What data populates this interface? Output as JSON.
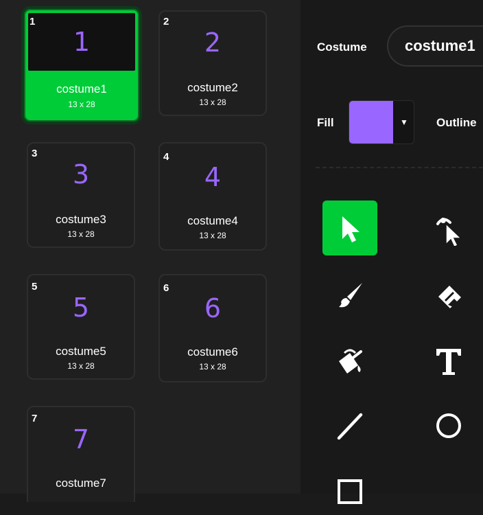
{
  "costumes": [
    {
      "index": "1",
      "thumb": "1",
      "name": "costume1",
      "size": "13 x 28",
      "selected": true
    },
    {
      "index": "2",
      "thumb": "2",
      "name": "costume2",
      "size": "13 x 28",
      "selected": false
    },
    {
      "index": "3",
      "thumb": "3",
      "name": "costume3",
      "size": "13 x 28",
      "selected": false
    },
    {
      "index": "4",
      "thumb": "4",
      "name": "costume4",
      "size": "13 x 28",
      "selected": false
    },
    {
      "index": "5",
      "thumb": "5",
      "name": "costume5",
      "size": "13 x 28",
      "selected": false
    },
    {
      "index": "6",
      "thumb": "6",
      "name": "costume6",
      "size": "13 x 28",
      "selected": false
    },
    {
      "index": "7",
      "thumb": "7",
      "name": "costume7",
      "size": "",
      "selected": false
    }
  ],
  "editor": {
    "costume_label": "Costume",
    "costume_name": "costume1",
    "fill_label": "Fill",
    "outline_label": "Outline",
    "fill_color": "#9966ff",
    "caret": "▼"
  },
  "tools": [
    {
      "name": "select-tool",
      "icon": "arrow-pointer-icon",
      "active": true
    },
    {
      "name": "reshape-tool",
      "icon": "reshape-icon",
      "active": false
    },
    {
      "name": "brush-tool",
      "icon": "brush-icon",
      "active": false
    },
    {
      "name": "eraser-tool",
      "icon": "eraser-icon",
      "active": false
    },
    {
      "name": "fill-tool",
      "icon": "paint-bucket-icon",
      "active": false
    },
    {
      "name": "text-tool",
      "icon": "text-icon",
      "active": false
    },
    {
      "name": "line-tool",
      "icon": "line-icon",
      "active": false
    },
    {
      "name": "circle-tool",
      "icon": "circle-icon",
      "active": false
    },
    {
      "name": "rectangle-tool",
      "icon": "rectangle-icon",
      "active": false
    }
  ],
  "colors": {
    "accent_green": "#00cc38",
    "thumb_purple": "#9a66ff",
    "panel_bg": "#212121",
    "editor_bg": "#191919"
  }
}
